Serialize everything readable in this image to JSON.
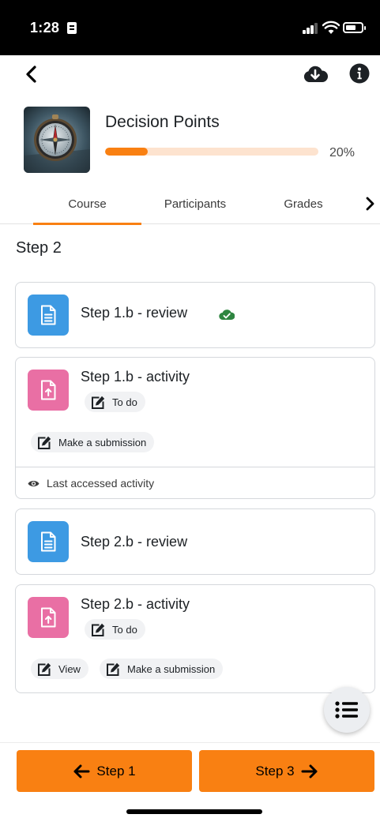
{
  "status_bar": {
    "time": "1:28"
  },
  "header": {
    "back_icon": "chevron-left-icon",
    "download_icon": "cloud-download-icon",
    "info_icon": "info-circle-icon"
  },
  "course": {
    "title": "Decision Points",
    "progress_percent": 20,
    "progress_label": "20%"
  },
  "tabs": [
    {
      "label": "Course",
      "active": true
    },
    {
      "label": "Participants",
      "active": false
    },
    {
      "label": "Grades",
      "active": false
    }
  ],
  "section": {
    "title": "Step 2"
  },
  "modules": [
    {
      "title": "Step 1.b - review",
      "type": "page",
      "status_icon": "cloud-done-icon"
    },
    {
      "title": "Step 1.b - activity",
      "type": "assign",
      "status_chip": "To do",
      "actions": [
        "Make a submission"
      ],
      "footer": "Last accessed activity"
    },
    {
      "title": "Step 2.b - review",
      "type": "page"
    },
    {
      "title": "Step 2.b - activity",
      "type": "assign",
      "status_chip": "To do",
      "actions": [
        "View",
        "Make a submission"
      ]
    }
  ],
  "navigation": {
    "prev_label": "Step 1",
    "next_label": "Step 3"
  },
  "colors": {
    "accent": "#f98012",
    "progress_track": "#fde3cf",
    "page_icon": "#3d9ae3",
    "assign_icon": "#e96fa4",
    "cloud_done": "#2e8540"
  }
}
